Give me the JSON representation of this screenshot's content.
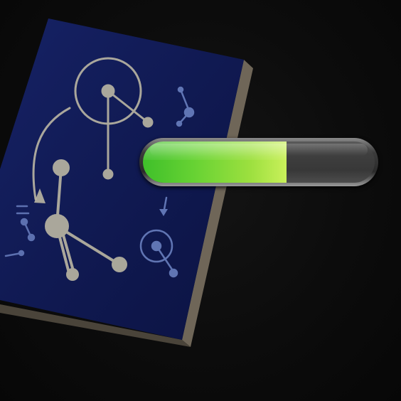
{
  "hud": {
    "progress_bar": {
      "value": 0.62,
      "fill_color": "#8fdc3a",
      "track_color": "#3f3f3f"
    }
  },
  "book": {
    "cover_color": "#101a55",
    "sketch_color": "#b9b6a3",
    "spine_color": "#7a7266"
  },
  "scene": {
    "background_color": "#0b0b0b"
  }
}
